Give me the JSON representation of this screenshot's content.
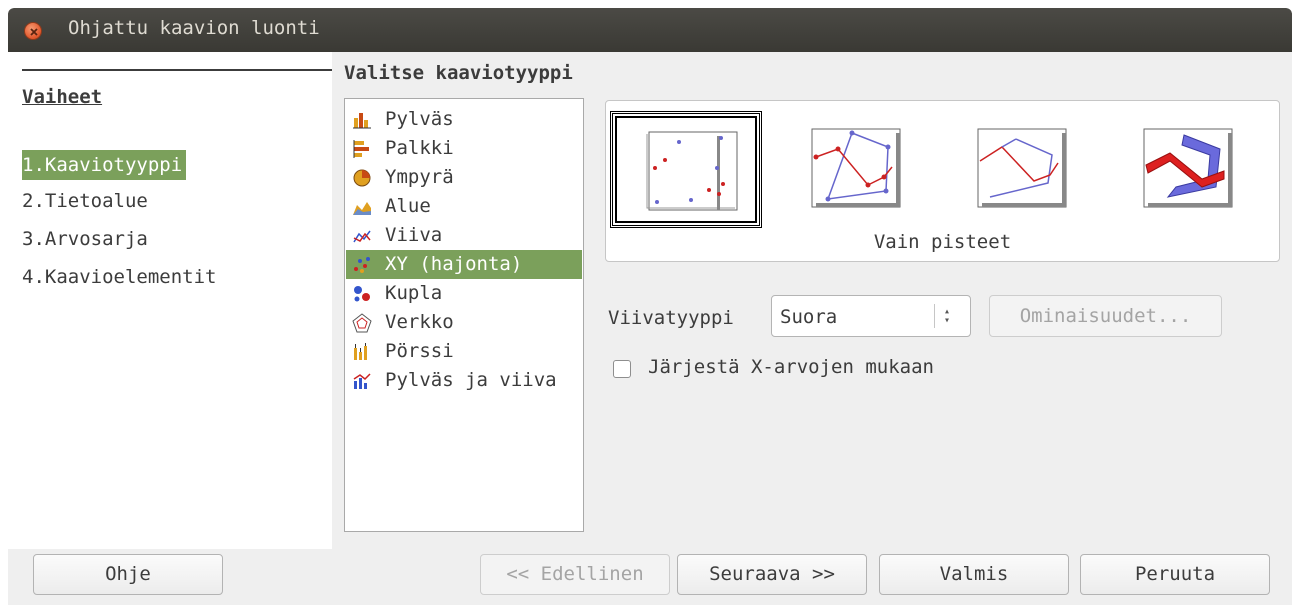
{
  "window": {
    "title": "Ohjattu kaavion luonti"
  },
  "steps": {
    "heading": "Vaiheet",
    "items": [
      {
        "label": "1.Kaaviotyyppi",
        "active": true
      },
      {
        "label": "2.Tietoalue",
        "active": false
      },
      {
        "label": "3.Arvosarja",
        "active": false
      },
      {
        "label": "4.Kaavioelementit",
        "active": false
      }
    ]
  },
  "main": {
    "section_title": "Valitse kaaviotyyppi",
    "chart_types": [
      {
        "label": "Pylväs",
        "icon": "column-chart-icon"
      },
      {
        "label": "Palkki",
        "icon": "bar-chart-icon"
      },
      {
        "label": "Ympyrä",
        "icon": "pie-chart-icon"
      },
      {
        "label": "Alue",
        "icon": "area-chart-icon"
      },
      {
        "label": "Viiva",
        "icon": "line-chart-icon"
      },
      {
        "label": "XY (hajonta)",
        "icon": "scatter-chart-icon",
        "selected": true
      },
      {
        "label": "Kupla",
        "icon": "bubble-chart-icon"
      },
      {
        "label": "Verkko",
        "icon": "net-chart-icon"
      },
      {
        "label": "Pörssi",
        "icon": "stock-chart-icon"
      },
      {
        "label": "Pylväs ja viiva",
        "icon": "column-line-chart-icon"
      }
    ],
    "variants": [
      {
        "icon": "points-only-icon",
        "selected": true
      },
      {
        "icon": "points-and-lines-icon",
        "selected": false
      },
      {
        "icon": "lines-only-icon",
        "selected": false
      },
      {
        "icon": "3d-lines-icon",
        "selected": false
      }
    ],
    "variant_label": "Vain pisteet",
    "line_type_label": "Viivatyyppi",
    "line_type_value": "Suora",
    "properties_button": "Ominaisuudet...",
    "sort_checkbox_label": "Järjestä X-arvojen mukaan",
    "sort_checked": false
  },
  "buttons": {
    "help": "Ohje",
    "previous": "<< Edellinen",
    "next": "Seuraava >>",
    "finish": "Valmis",
    "cancel": "Peruuta"
  },
  "colors": {
    "selection": "#7ba05b",
    "titlebar": "#3c3b37"
  }
}
